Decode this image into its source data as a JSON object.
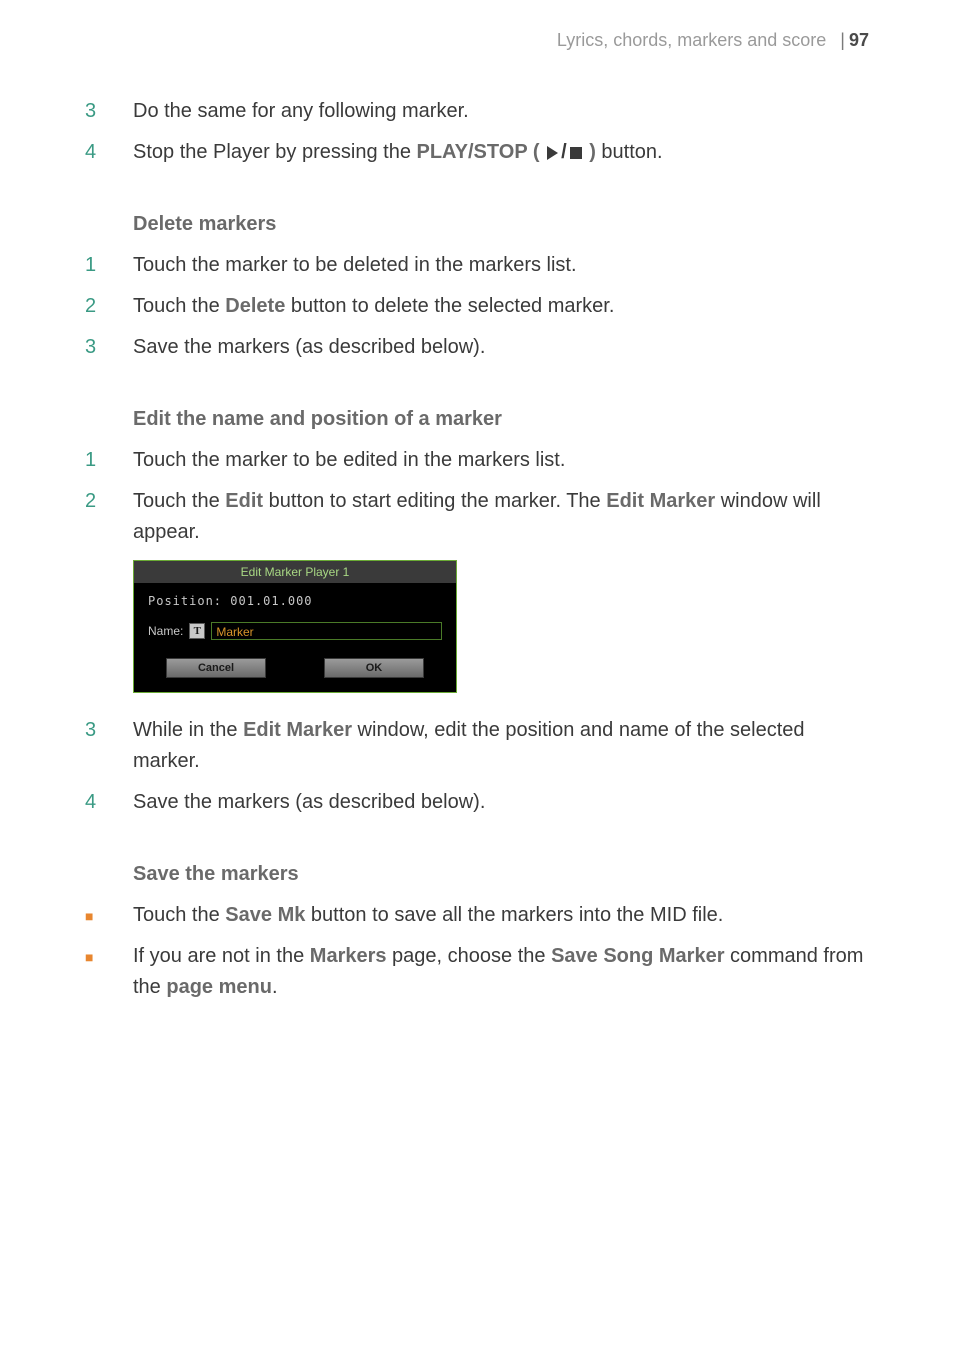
{
  "header": {
    "title": "Lyrics, chords, markers and score",
    "page": "97"
  },
  "section_a": {
    "items": [
      {
        "num": "3",
        "text": "Do the same for any following marker."
      },
      {
        "num": "4",
        "before": "Stop the Player by pressing the ",
        "label": "PLAY/STOP ( ",
        "label_close": " )",
        "after": " button."
      }
    ]
  },
  "section_b": {
    "heading": "Delete markers",
    "items": [
      {
        "num": "1",
        "text": "Touch the marker to be deleted in the markers list."
      },
      {
        "num": "2",
        "before": "Touch the ",
        "label": "Delete",
        "after": " button to delete the selected marker."
      },
      {
        "num": "3",
        "text": "Save the markers (as described below)."
      }
    ]
  },
  "section_c": {
    "heading": "Edit the name and position of a marker",
    "items_before": [
      {
        "num": "1",
        "text": "Touch the marker to be edited in the markers list."
      },
      {
        "num": "2",
        "before": "Touch the ",
        "label": "Edit",
        "mid": " button to start editing the marker. The ",
        "label2": "Edit Marker",
        "after": " window will appear."
      }
    ],
    "items_after": [
      {
        "num": "3",
        "before": "While in the ",
        "label": "Edit Marker",
        "after": " window, edit the position and name of the selected marker."
      },
      {
        "num": "4",
        "text": "Save the markers (as described below)."
      }
    ]
  },
  "dialog": {
    "title": "Edit Marker Player 1",
    "position_label": "Position:",
    "position_value": "001.01.000",
    "name_label": "Name:",
    "t_icon": "T",
    "name_value": "Marker",
    "cancel": "Cancel",
    "ok": "OK"
  },
  "section_d": {
    "heading": "Save the markers",
    "items": [
      {
        "before": "Touch the ",
        "label": "Save Mk",
        "after": " button to save all the markers into the MID file."
      },
      {
        "before": "If you are not in the ",
        "label": "Markers",
        "mid": " page, choose the ",
        "label2": "Save Song Marker",
        "mid2": " command from the ",
        "label3": "page menu",
        "after": "."
      }
    ]
  }
}
